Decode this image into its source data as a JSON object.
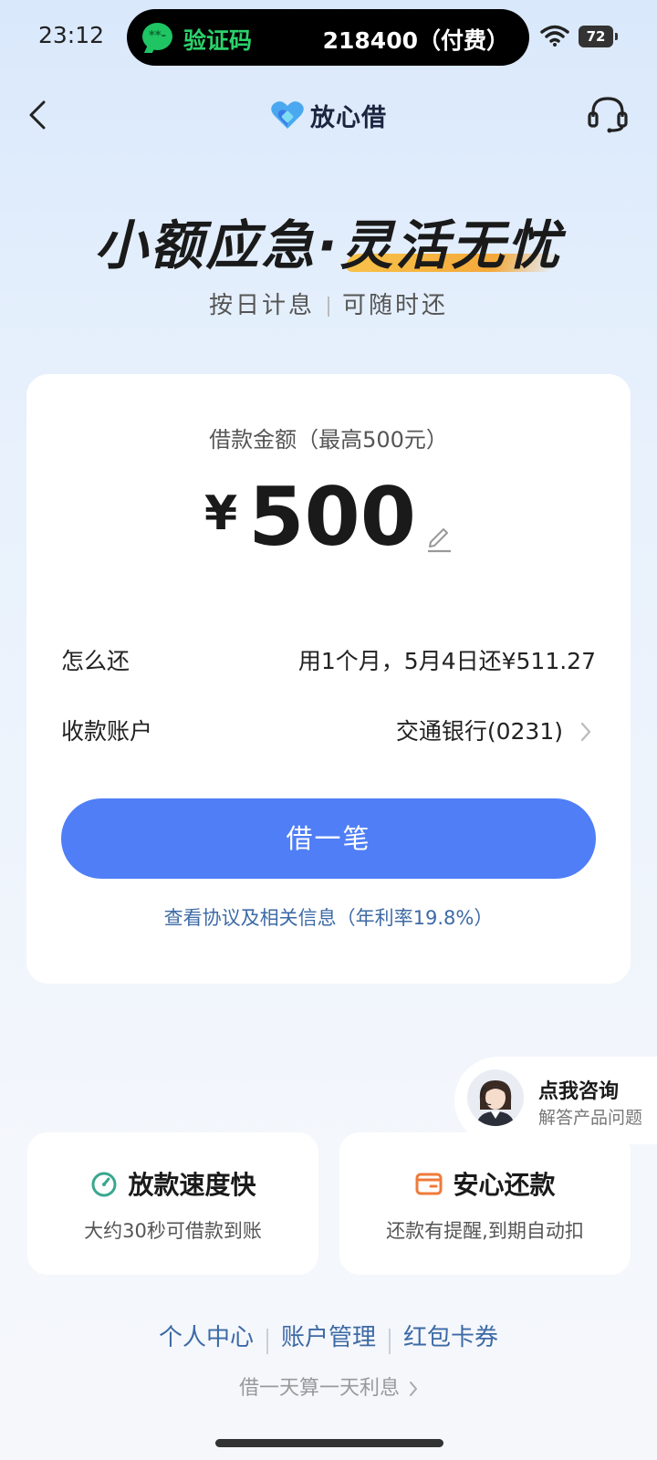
{
  "status_bar": {
    "time": "23:12",
    "sms_title": "验证码",
    "sms_code": "218400（付费）",
    "sms_icon_text": "**-",
    "battery": "72"
  },
  "nav": {
    "back_icon": "chevron-left-icon",
    "logo_text": "放心借",
    "service_icon": "headset-icon"
  },
  "hero": {
    "title_part1": "小额应急·",
    "title_part2": "灵活无忧",
    "subtitle_left": "按日计息",
    "subtitle_right": "可随时还"
  },
  "loan": {
    "amount_label": "借款金额（最高500元）",
    "currency": "¥",
    "amount": "500",
    "repay_label": "怎么还",
    "repay_value": "用1个月，5月4日还¥511.27",
    "account_label": "收款账户",
    "account_value": "交通银行(0231)",
    "borrow_button": "借一笔",
    "agreement_link": "查看协议及相关信息（年利率19.8%）"
  },
  "consult": {
    "title": "点我咨询",
    "subtitle": "解答产品问题"
  },
  "features": [
    {
      "title": "放款速度快",
      "desc": "大约30秒可借款到账",
      "icon": "timer-icon",
      "color": "#3aa78f"
    },
    {
      "title": "安心还款",
      "desc": "还款有提醒,到期自动扣",
      "icon": "wallet-icon",
      "color": "#f07a3a"
    }
  ],
  "footer": {
    "links": [
      "个人中心",
      "账户管理",
      "红包卡券"
    ],
    "note": "借一天算一天利息"
  },
  "colors": {
    "primary": "#4f7ef6",
    "link": "#3d6aa6",
    "accent_yellow": "#f8c24a",
    "sms_green": "#2bd26a"
  }
}
